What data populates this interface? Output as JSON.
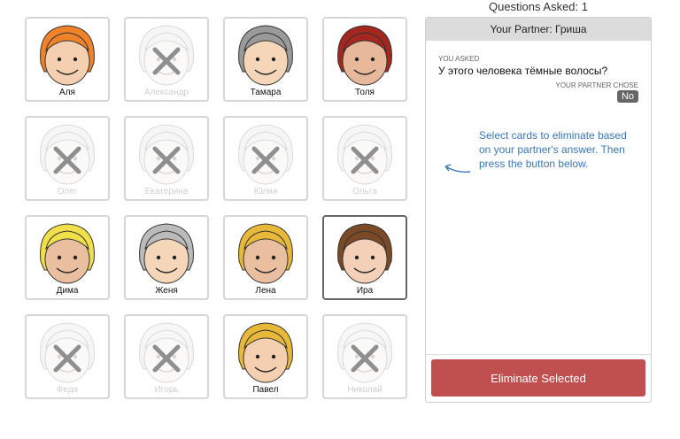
{
  "header": {
    "questions_asked": "Questions Asked: 1"
  },
  "colors": {
    "button": "#c0504f",
    "hint": "#3a76b3",
    "header_bg": "#dcdcdc"
  },
  "cards": [
    {
      "name": "Аля",
      "eliminated": false,
      "selected": false,
      "hair": "#f0822a",
      "skin": "#f4d0b0"
    },
    {
      "name": "Александр",
      "eliminated": true,
      "selected": false,
      "hair": "#cfcfcf",
      "skin": "#e9dfd7"
    },
    {
      "name": "Тамара",
      "eliminated": false,
      "selected": false,
      "hair": "#9a9a9a",
      "skin": "#f6d6b8"
    },
    {
      "name": "Толя",
      "eliminated": false,
      "selected": false,
      "hair": "#a3271f",
      "skin": "#e8b89a"
    },
    {
      "name": "Олег",
      "eliminated": true,
      "selected": false,
      "hair": "#cfcfcf",
      "skin": "#e9dfd7"
    },
    {
      "name": "Екатерина",
      "eliminated": true,
      "selected": false,
      "hair": "#cfcfcf",
      "skin": "#e9dfd7"
    },
    {
      "name": "Юлия",
      "eliminated": true,
      "selected": false,
      "hair": "#cfcfcf",
      "skin": "#e9dfd7"
    },
    {
      "name": "Ольга",
      "eliminated": true,
      "selected": false,
      "hair": "#cfcfcf",
      "skin": "#e9dfd7"
    },
    {
      "name": "Дима",
      "eliminated": false,
      "selected": false,
      "hair": "#f1e04a",
      "skin": "#e9bfa0"
    },
    {
      "name": "Женя",
      "eliminated": false,
      "selected": false,
      "hair": "#bbbbbb",
      "skin": "#f6d6b8"
    },
    {
      "name": "Лена",
      "eliminated": false,
      "selected": false,
      "hair": "#e8b838",
      "skin": "#e9bfa0"
    },
    {
      "name": "Ира",
      "eliminated": false,
      "selected": true,
      "hair": "#7a4a26",
      "skin": "#f4d0b8"
    },
    {
      "name": "Федя",
      "eliminated": true,
      "selected": false,
      "hair": "#cfcfcf",
      "skin": "#e9dfd7"
    },
    {
      "name": "Игорь",
      "eliminated": true,
      "selected": false,
      "hair": "#cfcfcf",
      "skin": "#e9dfd7"
    },
    {
      "name": "Павел",
      "eliminated": false,
      "selected": false,
      "hair": "#e8b838",
      "skin": "#f4d0b0"
    },
    {
      "name": "Николай",
      "eliminated": true,
      "selected": false,
      "hair": "#cfcfcf",
      "skin": "#e9dfd7"
    }
  ],
  "panel": {
    "title": "Your Partner: Гриша",
    "asked_label": "YOU ASKED",
    "question": "У этого человека тёмные волосы?",
    "chose_label": "YOUR PARTNER CHOSE",
    "answer": "No",
    "hint": "Select cards to eliminate based on your partner's answer. Then press the button below.",
    "hint_icon": "curved-arrow-left-icon",
    "button_label": "Eliminate Selected"
  }
}
